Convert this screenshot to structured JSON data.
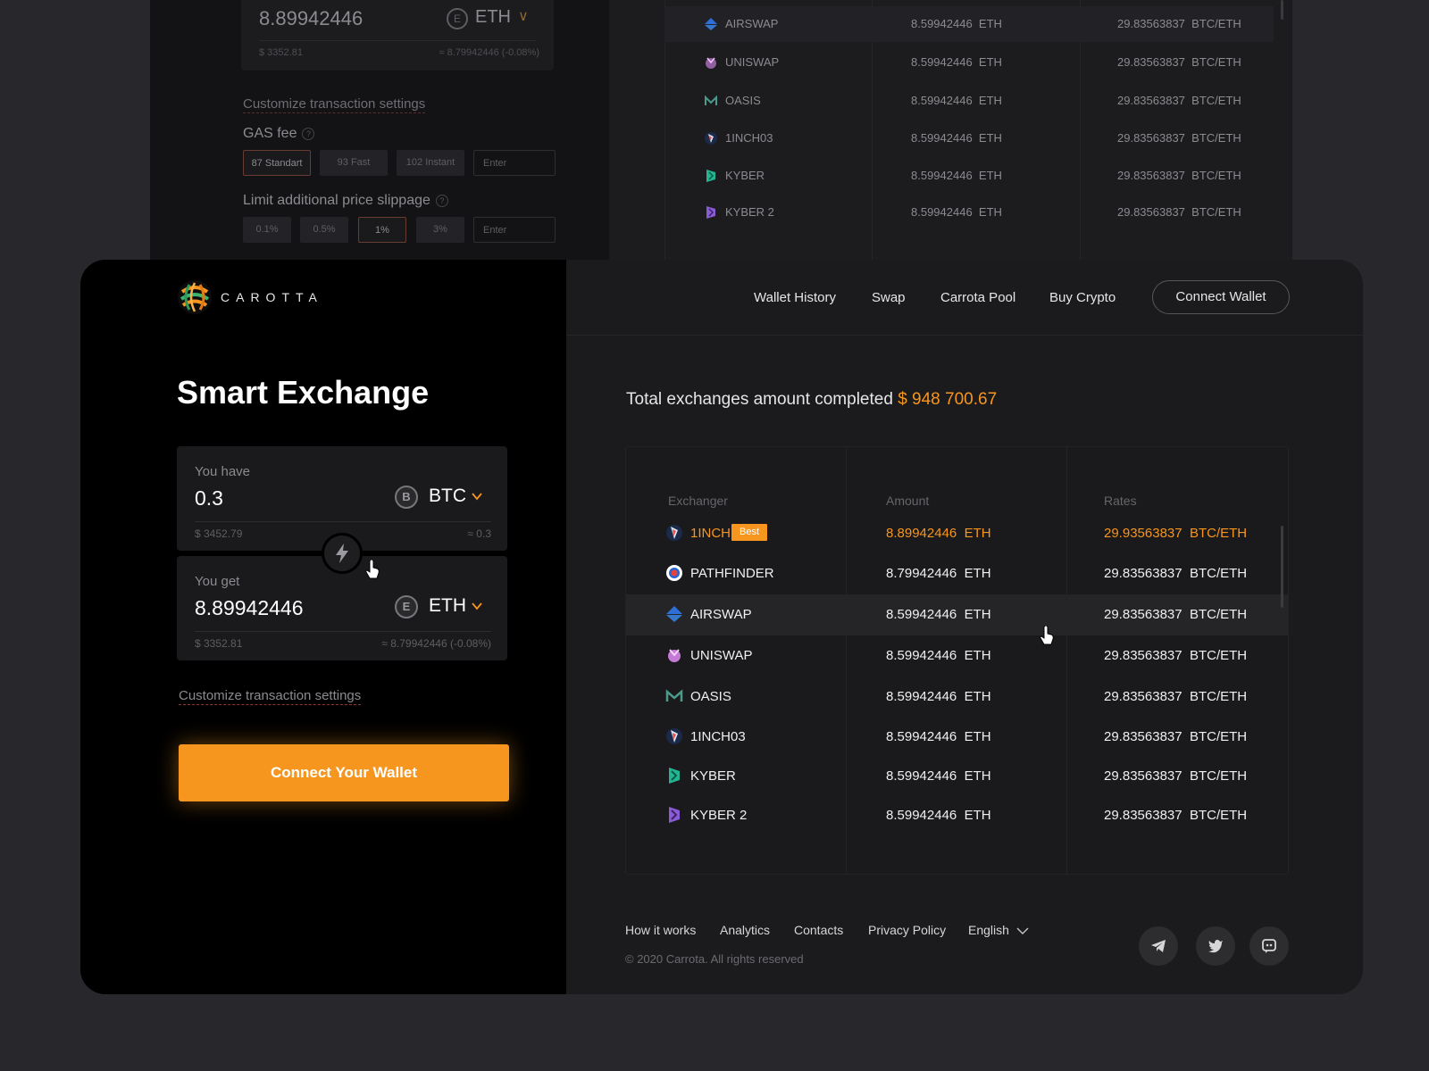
{
  "background_screen": {
    "you_get_value": "8.89942446",
    "you_get_currency": "ETH",
    "you_get_usd": "$ 3352.81",
    "you_get_approx": "≈ 8.79942446 (-0.08%)",
    "customize_label": "Customize transaction settings",
    "gas_fee_label": "GAS fee",
    "gas_options": [
      "87 Standart",
      "93 Fast",
      "102 Instant"
    ],
    "gas_enter_placeholder": "Enter",
    "slippage_label": "Limit additional price slippage",
    "slippage_options": [
      "0.1%",
      "0.5%",
      "1%",
      "3%"
    ],
    "slippage_enter_placeholder": "Enter",
    "rows": [
      {
        "name": "AIRSWAP",
        "amount": "8.59942446",
        "unit": "ETH",
        "rate": "29.83563837",
        "pair": "BTC/ETH"
      },
      {
        "name": "UNISWAP",
        "amount": "8.59942446",
        "unit": "ETH",
        "rate": "29.83563837",
        "pair": "BTC/ETH"
      },
      {
        "name": "OASIS",
        "amount": "8.59942446",
        "unit": "ETH",
        "rate": "29.83563837",
        "pair": "BTC/ETH"
      },
      {
        "name": "1INCH03",
        "amount": "8.59942446",
        "unit": "ETH",
        "rate": "29.83563837",
        "pair": "BTC/ETH"
      },
      {
        "name": "KYBER",
        "amount": "8.59942446",
        "unit": "ETH",
        "rate": "29.83563837",
        "pair": "BTC/ETH"
      },
      {
        "name": "KYBER 2",
        "amount": "8.59942446",
        "unit": "ETH",
        "rate": "29.83563837",
        "pair": "BTC/ETH"
      }
    ]
  },
  "brand": {
    "name": "CAROTTA",
    "icon": "carotta-logo-icon"
  },
  "nav": {
    "items": [
      "Wallet History",
      "Swap",
      "Carrota Pool",
      "Buy Crypto"
    ],
    "connect_label": "Connect Wallet"
  },
  "exchange": {
    "title": "Smart Exchange",
    "have": {
      "label": "You have",
      "value": "0.3",
      "coin_symbol": "B",
      "currency": "BTC",
      "usd": "$ 3452.79",
      "approx": "≈ 0.3"
    },
    "get": {
      "label": "You get",
      "value": "8.89942446",
      "coin_symbol": "E",
      "currency": "ETH",
      "usd": "$ 3352.81",
      "approx": "≈ 8.79942446 (-0.08%)"
    },
    "swap_icon": "lightning-icon",
    "customize_label": "Customize transaction settings",
    "connect_label": "Connect Your Wallet"
  },
  "summary": {
    "label": "Total exchanges amount completed",
    "amount": "$ 948 700.67"
  },
  "table": {
    "headers": [
      "Exchanger",
      "Amount",
      "Rates"
    ],
    "rows": [
      {
        "name": "1INCH",
        "badge": "Best",
        "amount": "8.89942446",
        "unit": "ETH",
        "rate": "29.93563837",
        "pair": "BTC/ETH"
      },
      {
        "name": "PATHFINDER",
        "amount": "8.79942446",
        "unit": "ETH",
        "rate": "29.83563837",
        "pair": "BTC/ETH"
      },
      {
        "name": "AIRSWAP",
        "amount": "8.59942446",
        "unit": "ETH",
        "rate": "29.83563837",
        "pair": "BTC/ETH"
      },
      {
        "name": "UNISWAP",
        "amount": "8.59942446",
        "unit": "ETH",
        "rate": "29.83563837",
        "pair": "BTC/ETH"
      },
      {
        "name": "OASIS",
        "amount": "8.59942446",
        "unit": "ETH",
        "rate": "29.83563837",
        "pair": "BTC/ETH"
      },
      {
        "name": "1INCH03",
        "amount": "8.59942446",
        "unit": "ETH",
        "rate": "29.83563837",
        "pair": "BTC/ETH"
      },
      {
        "name": "KYBER",
        "amount": "8.59942446",
        "unit": "ETH",
        "rate": "29.83563837",
        "pair": "BTC/ETH"
      },
      {
        "name": "KYBER 2",
        "amount": "8.59942446",
        "unit": "ETH",
        "rate": "29.83563837",
        "pair": "BTC/ETH"
      }
    ]
  },
  "footer": {
    "links": [
      "How it works",
      "Analytics",
      "Contacts",
      "Privacy Policy"
    ],
    "language": "English",
    "copyright": "© 2020 Carrota. All rights reserved",
    "social": [
      "telegram-icon",
      "twitter-icon",
      "discord-icon"
    ]
  },
  "colors": {
    "accent": "#f7961f",
    "card_left": "#000000",
    "card_right": "#1b1b1d",
    "page_bg": "#28282c"
  }
}
